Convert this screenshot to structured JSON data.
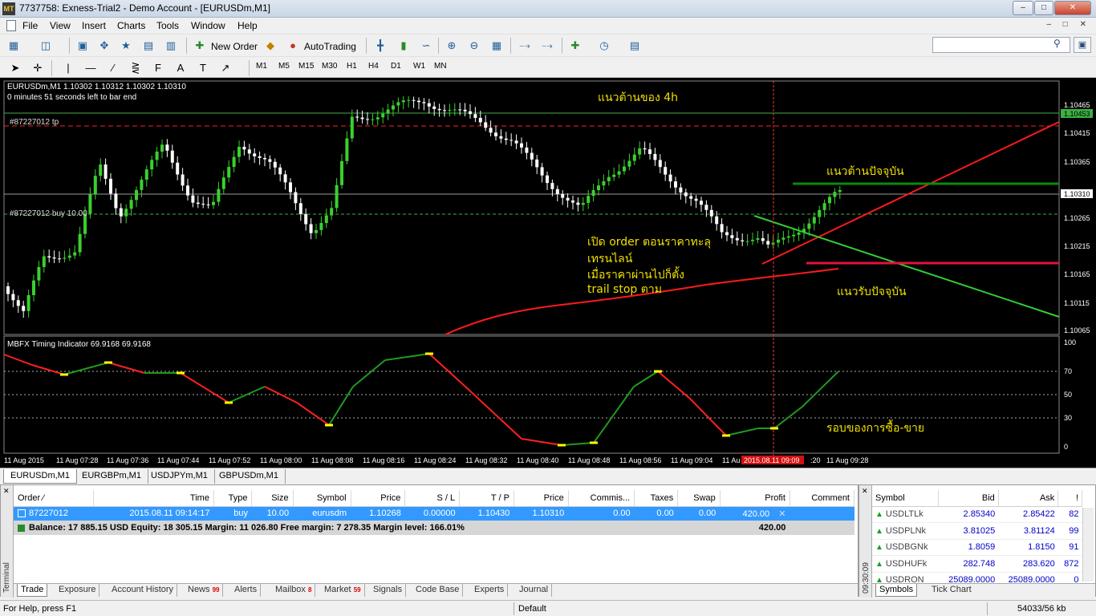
{
  "window": {
    "app_icon": "MT",
    "title": "7737758: Exness-Trial2 - Demo Account - [EURUSDm,M1]",
    "minimize": "–",
    "maximize": "□",
    "close": "✕",
    "mdi_controls": "– □ ✕"
  },
  "menu": [
    "File",
    "View",
    "Insert",
    "Charts",
    "Tools",
    "Window",
    "Help"
  ],
  "toolbar": {
    "new_order": "New Order",
    "autotrading": "AutoTrading",
    "timeframes": [
      "M1",
      "M5",
      "M15",
      "M30",
      "H1",
      "H4",
      "D1",
      "W1",
      "MN"
    ],
    "search_placeholder": ""
  },
  "chart": {
    "header_line": "EURUSDm,M1  1.10302 1.10312 1.10302 1.10310",
    "bar_timer": "0 minutes 51 seconds left to bar end",
    "tp_label": "#87227012 tp",
    "buy_label": "#87227012 buy 10.00",
    "indicator_label": "MBFX Timing Indicator 69.9168 69.9168",
    "annotations": {
      "resistance_4h": "แนวต้านของ 4h",
      "current_resistance": "แนวต้านปัจจุบัน",
      "current_support": "แนวรับปัจจุบัน",
      "cycle": "รอบของการซื้อ-ขาย",
      "note_lines": [
        "เปิด order  ตอนราคาทะลุ",
        "เทรนไลน์",
        "เมื่อราคาผ่านไปก็ตั้ง",
        "trail stop ตาม"
      ]
    },
    "price_labels": [
      "1.10465",
      "1.10415",
      "1.10365",
      "1.10265",
      "1.10215",
      "1.10165",
      "1.10115",
      "1.10065"
    ],
    "price_tp_box": "1.10453",
    "price_current_box": "1.10310",
    "indicator_scale": [
      "100",
      "70",
      "50",
      "30",
      "0"
    ],
    "time_labels": [
      "11 Aug 2015",
      "11 Aug 07:28",
      "11 Aug 07:36",
      "11 Aug 07:44",
      "11 Aug 07:52",
      "11 Aug 08:00",
      "11 Aug 08:08",
      "11 Aug 08:16",
      "11 Aug 08:24",
      "11 Aug 08:32",
      "11 Aug 08:40",
      "11 Aug 08:48",
      "11 Aug 08:56",
      "11 Aug 09:04",
      "11 Au",
      ":20",
      "11 Aug 09:28"
    ],
    "crosshair_time": "2015.08.11 09:09",
    "colors": {
      "background": "#000000",
      "bull": "#39d12e",
      "bear": "#ffffff",
      "tp_line": "#ff2020",
      "trend_red": "#ff1a1a",
      "trend_green": "#33cc33",
      "annotation": "#f0e000",
      "indicator_up": "#1f9a1f",
      "indicator_down": "#ff2020",
      "indicator_turn": "#ffff00"
    }
  },
  "chart_tabs": [
    "EURUSDm,M1",
    "EURGBPm,M1",
    "USDJPYm,M1",
    "GBPUSDm,M1"
  ],
  "terminal": {
    "side_label": "Terminal",
    "close": "✕",
    "columns": [
      "Order  ∕",
      "Time",
      "Type",
      "Size",
      "Symbol",
      "Price",
      "S / L",
      "T / P",
      "Price",
      "Commis...",
      "Taxes",
      "Swap",
      "Profit",
      "Comment"
    ],
    "order": {
      "order": "87227012",
      "time": "2015.08.11 09:14:17",
      "type": "buy",
      "size": "10.00",
      "symbol": "eurusdm",
      "price": "1.10268",
      "sl": "0.00000",
      "tp": "1.10430",
      "current_price": "1.10310",
      "commission": "0.00",
      "taxes": "0.00",
      "swap": "0.00",
      "profit": "420.00",
      "close_icon": "✕"
    },
    "balance_line": "Balance: 17 885.15 USD  Equity: 18 305.15  Margin: 11 026.80  Free margin: 7 278.35  Margin level: 166.01%",
    "balance_profit": "420.00",
    "tabs": [
      {
        "label": "Trade",
        "badge": ""
      },
      {
        "label": "Exposure",
        "badge": ""
      },
      {
        "label": "Account History",
        "badge": ""
      },
      {
        "label": "News",
        "badge": "99"
      },
      {
        "label": "Alerts",
        "badge": ""
      },
      {
        "label": "Mailbox",
        "badge": "8"
      },
      {
        "label": "Market",
        "badge": "59"
      },
      {
        "label": "Signals",
        "badge": ""
      },
      {
        "label": "Code Base",
        "badge": ""
      },
      {
        "label": "Experts",
        "badge": ""
      },
      {
        "label": "Journal",
        "badge": ""
      }
    ]
  },
  "market_watch": {
    "time": "09:30:09",
    "columns": [
      "Symbol",
      "Bid",
      "Ask",
      "!"
    ],
    "rows": [
      {
        "symbol": "USDLTLk",
        "bid": "2.85340",
        "ask": "2.85422",
        "spread": "82"
      },
      {
        "symbol": "USDPLNk",
        "bid": "3.81025",
        "ask": "3.81124",
        "spread": "99"
      },
      {
        "symbol": "USDBGNk",
        "bid": "1.8059",
        "ask": "1.8150",
        "spread": "91"
      },
      {
        "symbol": "USDHUFk",
        "bid": "282.748",
        "ask": "283.620",
        "spread": "872"
      },
      {
        "symbol": "USDRON",
        "bid": "25089.0000",
        "ask": "25089.0000",
        "spread": "0"
      }
    ],
    "tabs": [
      "Symbols",
      "Tick Chart"
    ]
  },
  "status": {
    "help": "For Help, press F1",
    "profile": "Default",
    "traffic": "54033/56 kb"
  }
}
